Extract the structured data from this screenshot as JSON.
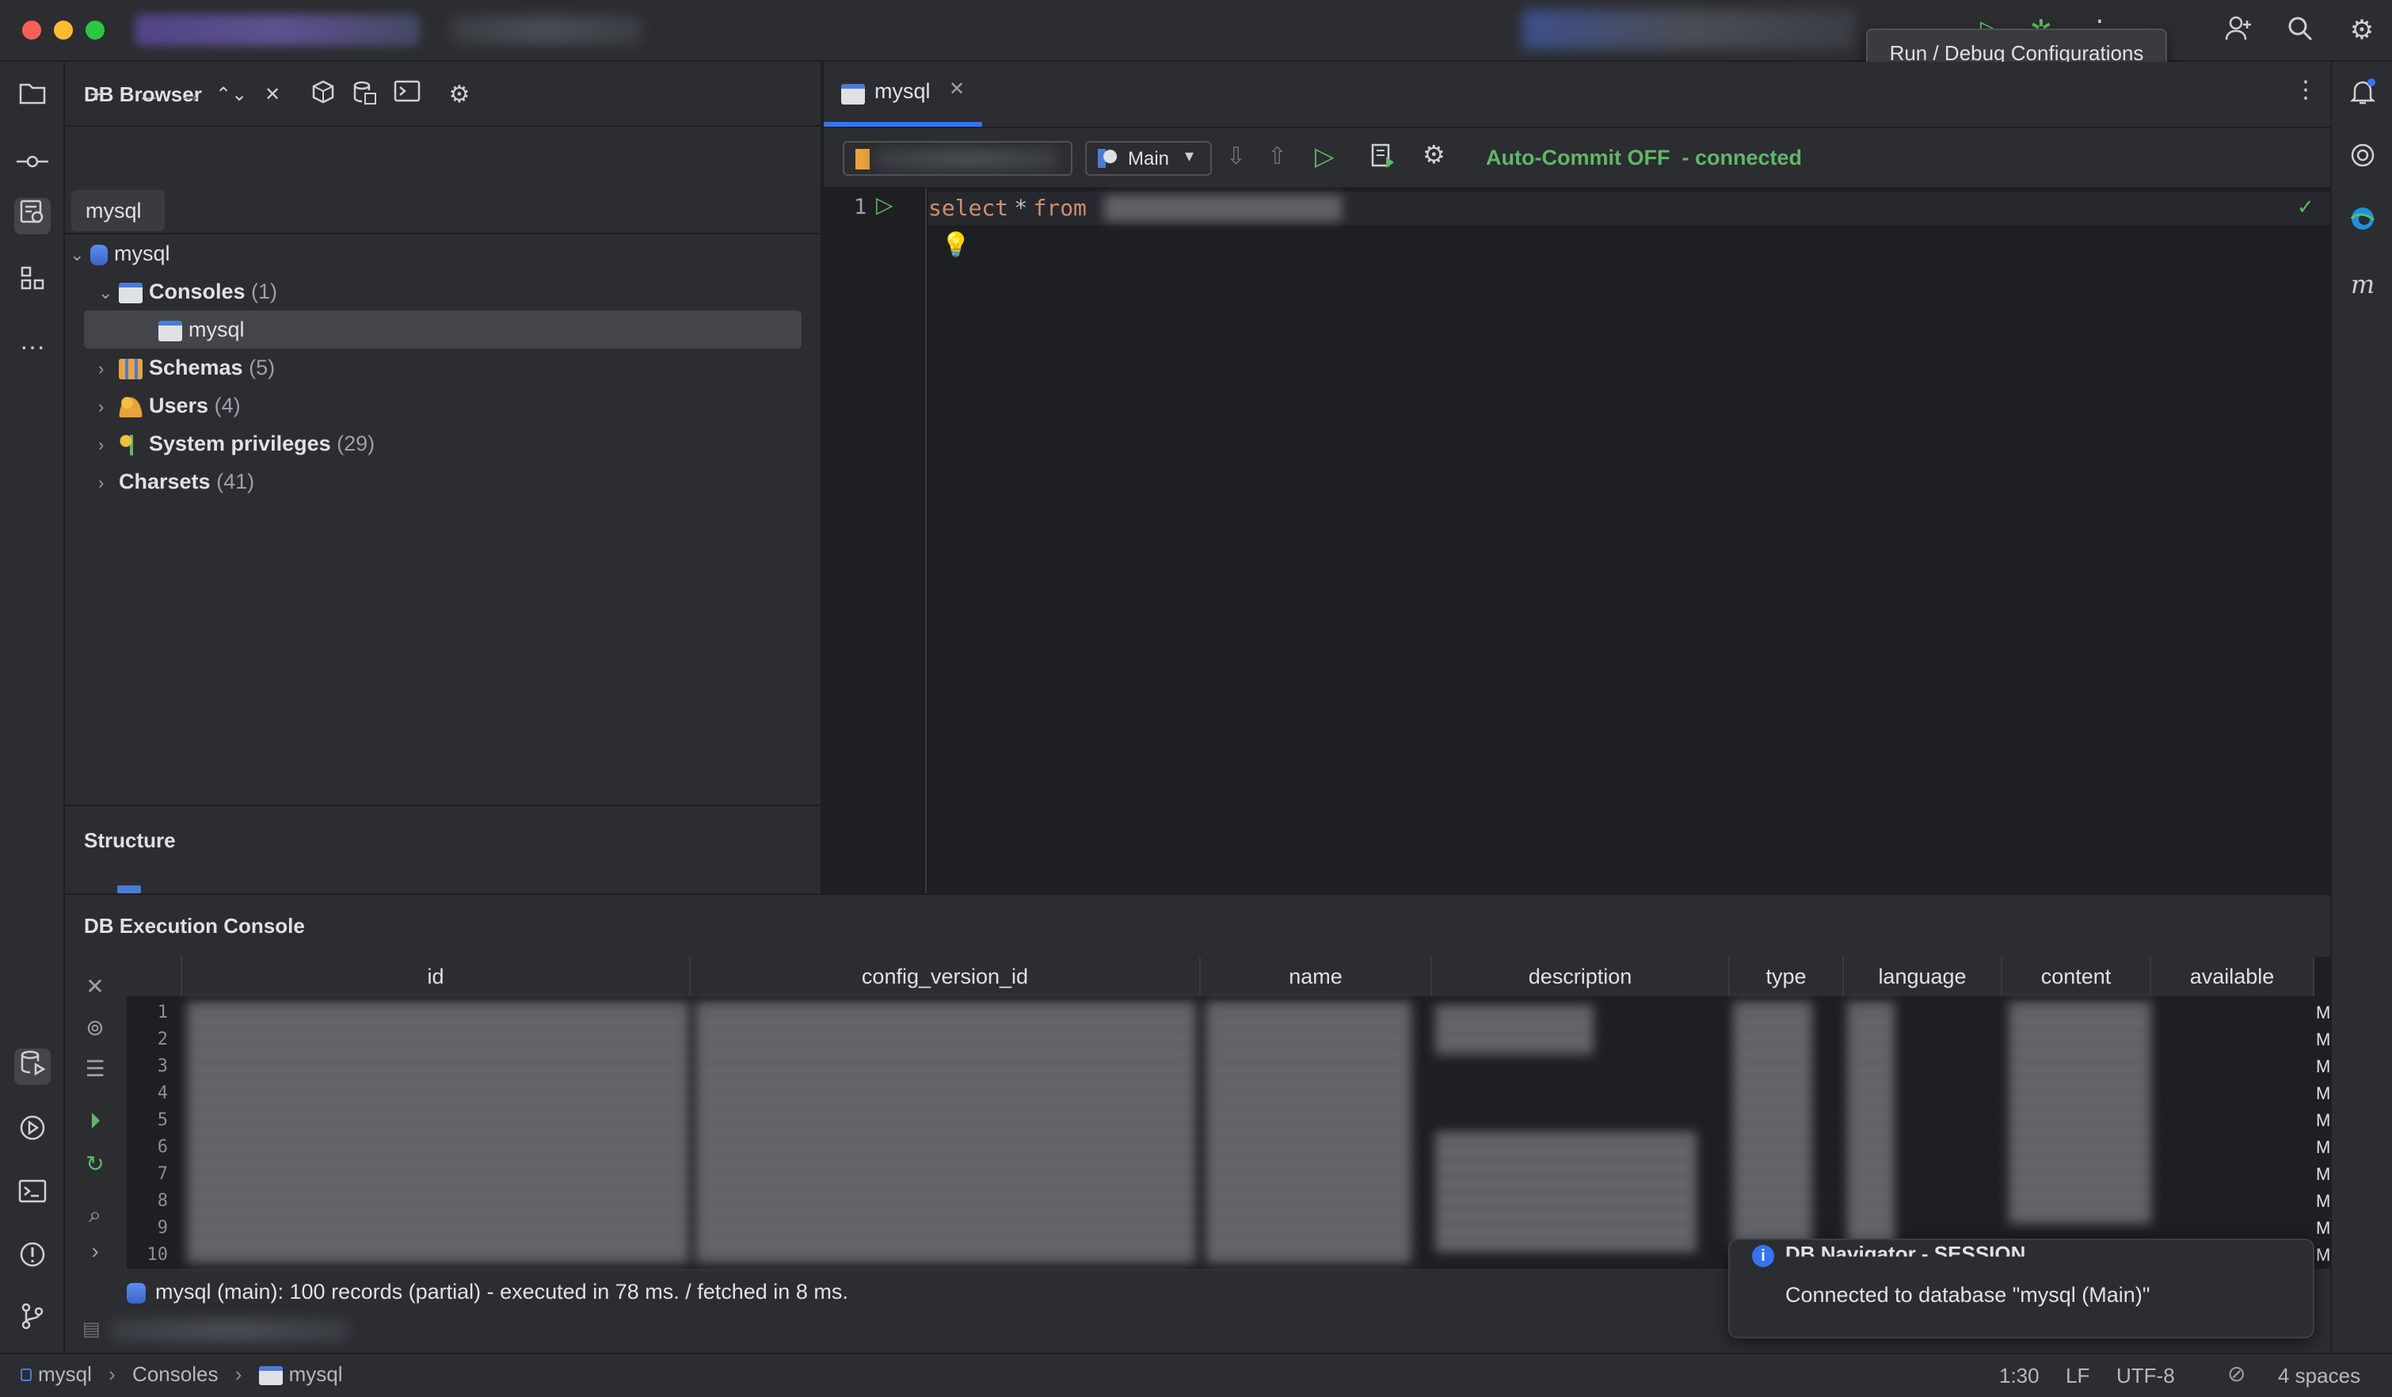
{
  "tooltip": {
    "text": "Run / Debug Configurations"
  },
  "db_browser": {
    "title": "DB Browser",
    "connection_tab": "mysql",
    "tree": [
      {
        "label": "mysql",
        "count": ""
      },
      {
        "label": "Consoles",
        "count": "(1)"
      },
      {
        "label": "mysql",
        "count": ""
      },
      {
        "label": "Schemas",
        "count": "(5)"
      },
      {
        "label": "Users",
        "count": "(4)"
      },
      {
        "label": "System privileges",
        "count": "(29)"
      },
      {
        "label": "Charsets",
        "count": "(41)"
      }
    ],
    "structure_title": "Structure"
  },
  "editor": {
    "tab_label": "mysql",
    "schema_selector": "Main",
    "autocommit": "Auto-Commit OFF",
    "connection_state": "- connected",
    "line_number": "1",
    "code_keyword1": "select",
    "code_star": "*",
    "code_keyword2": "from"
  },
  "console": {
    "title": "DB Execution Console",
    "columns": [
      "id",
      "config_version_id",
      "name",
      "description",
      "type",
      "language",
      "content",
      "available"
    ],
    "row_numbers": [
      "1",
      "2",
      "3",
      "4",
      "5",
      "6",
      "7",
      "8",
      "9",
      "10"
    ],
    "trailing_cell": "M",
    "status_message": "mysql (main): 100 records  (partial) - executed in 78 ms. / fetched in 8 ms."
  },
  "notification": {
    "title": "DB Navigator - SESSION",
    "message": "Connected to database \"mysql (Main)\""
  },
  "statusbar": {
    "breadcrumbs": [
      "mysql",
      "Consoles",
      "mysql"
    ],
    "position": "1:30",
    "line_ending": "LF",
    "encoding": "UTF-8",
    "indent": "4 spaces"
  },
  "colors": {
    "accent_blue": "#3574f0",
    "success_green": "#5fb865",
    "keyword_orange": "#cf8e6d",
    "selection": "#43454a"
  }
}
